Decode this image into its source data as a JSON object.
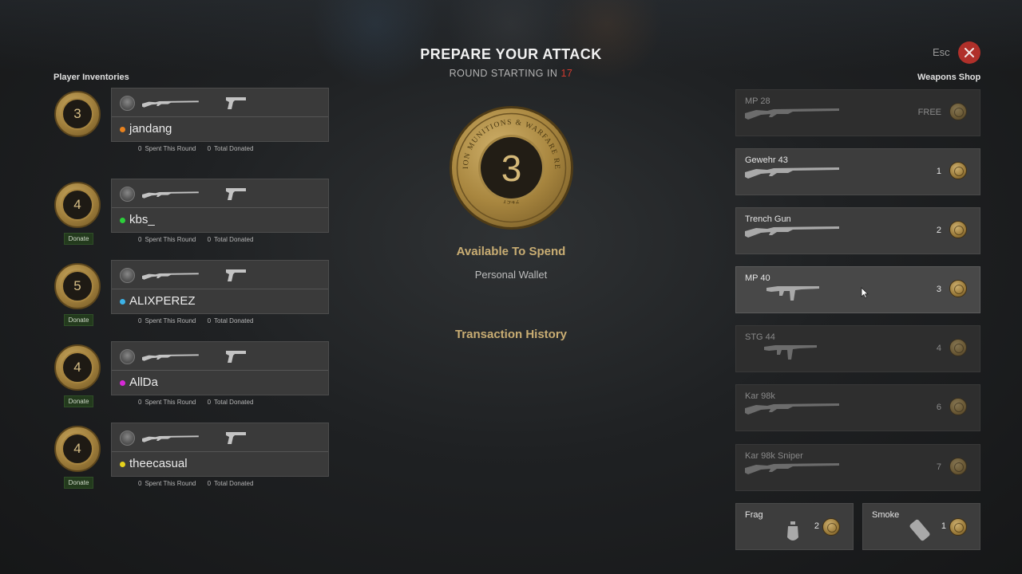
{
  "header": {
    "title": "PREPARE YOUR ATTACK",
    "subtitle": "ROUND STARTING IN",
    "countdown": "17",
    "esc_label": "Esc",
    "close_icon": "close-icon"
  },
  "inventories": {
    "title": "Player Inventories",
    "spent_label": "Spent This Round",
    "donated_label": "Total Donated",
    "donate_label": "Donate",
    "players": [
      {
        "name": "jandang",
        "coins": "3",
        "spent": "0",
        "donated": "0",
        "dot_color": "#e8821e",
        "show_donate": false
      },
      {
        "name": "kbs_",
        "coins": "4",
        "spent": "0",
        "donated": "0",
        "dot_color": "#2ccf3a",
        "show_donate": true
      },
      {
        "name": "ALIXPEREZ",
        "coins": "5",
        "spent": "0",
        "donated": "0",
        "dot_color": "#3cb3e8",
        "show_donate": true
      },
      {
        "name": "AllDa",
        "coins": "4",
        "spent": "0",
        "donated": "0",
        "dot_color": "#d629d6",
        "show_donate": true
      },
      {
        "name": "theecasual",
        "coins": "4",
        "spent": "0",
        "donated": "0",
        "dot_color": "#e5d21c",
        "show_donate": true
      }
    ]
  },
  "wallet": {
    "coins": "3",
    "coin_ring_text": "BATTALION MUNITIONS & WARFARE RESERVES",
    "coin_year": "1942",
    "available_label": "Available To Spend",
    "wallet_label": "Personal Wallet",
    "history_label": "Transaction History"
  },
  "shop": {
    "title": "Weapons Shop",
    "weapons": [
      {
        "name": "MP 28",
        "price": "FREE",
        "state": "dim",
        "icon": "smg-icon"
      },
      {
        "name": "Gewehr 43",
        "price": "1",
        "state": "normal",
        "icon": "rifle-icon"
      },
      {
        "name": "Trench Gun",
        "price": "2",
        "state": "normal",
        "icon": "shotgun-icon"
      },
      {
        "name": "MP 40",
        "price": "3",
        "state": "hover",
        "icon": "smg-icon"
      },
      {
        "name": "STG 44",
        "price": "4",
        "state": "dim",
        "icon": "assault-rifle-icon"
      },
      {
        "name": "Kar 98k",
        "price": "6",
        "state": "dim",
        "icon": "rifle-icon"
      },
      {
        "name": "Kar 98k Sniper",
        "price": "7",
        "state": "dim",
        "icon": "sniper-rifle-icon"
      }
    ],
    "equipment": [
      {
        "name": "Frag",
        "price": "2",
        "icon": "grenade-icon"
      },
      {
        "name": "Smoke",
        "price": "1",
        "icon": "smoke-grenade-icon"
      }
    ]
  }
}
